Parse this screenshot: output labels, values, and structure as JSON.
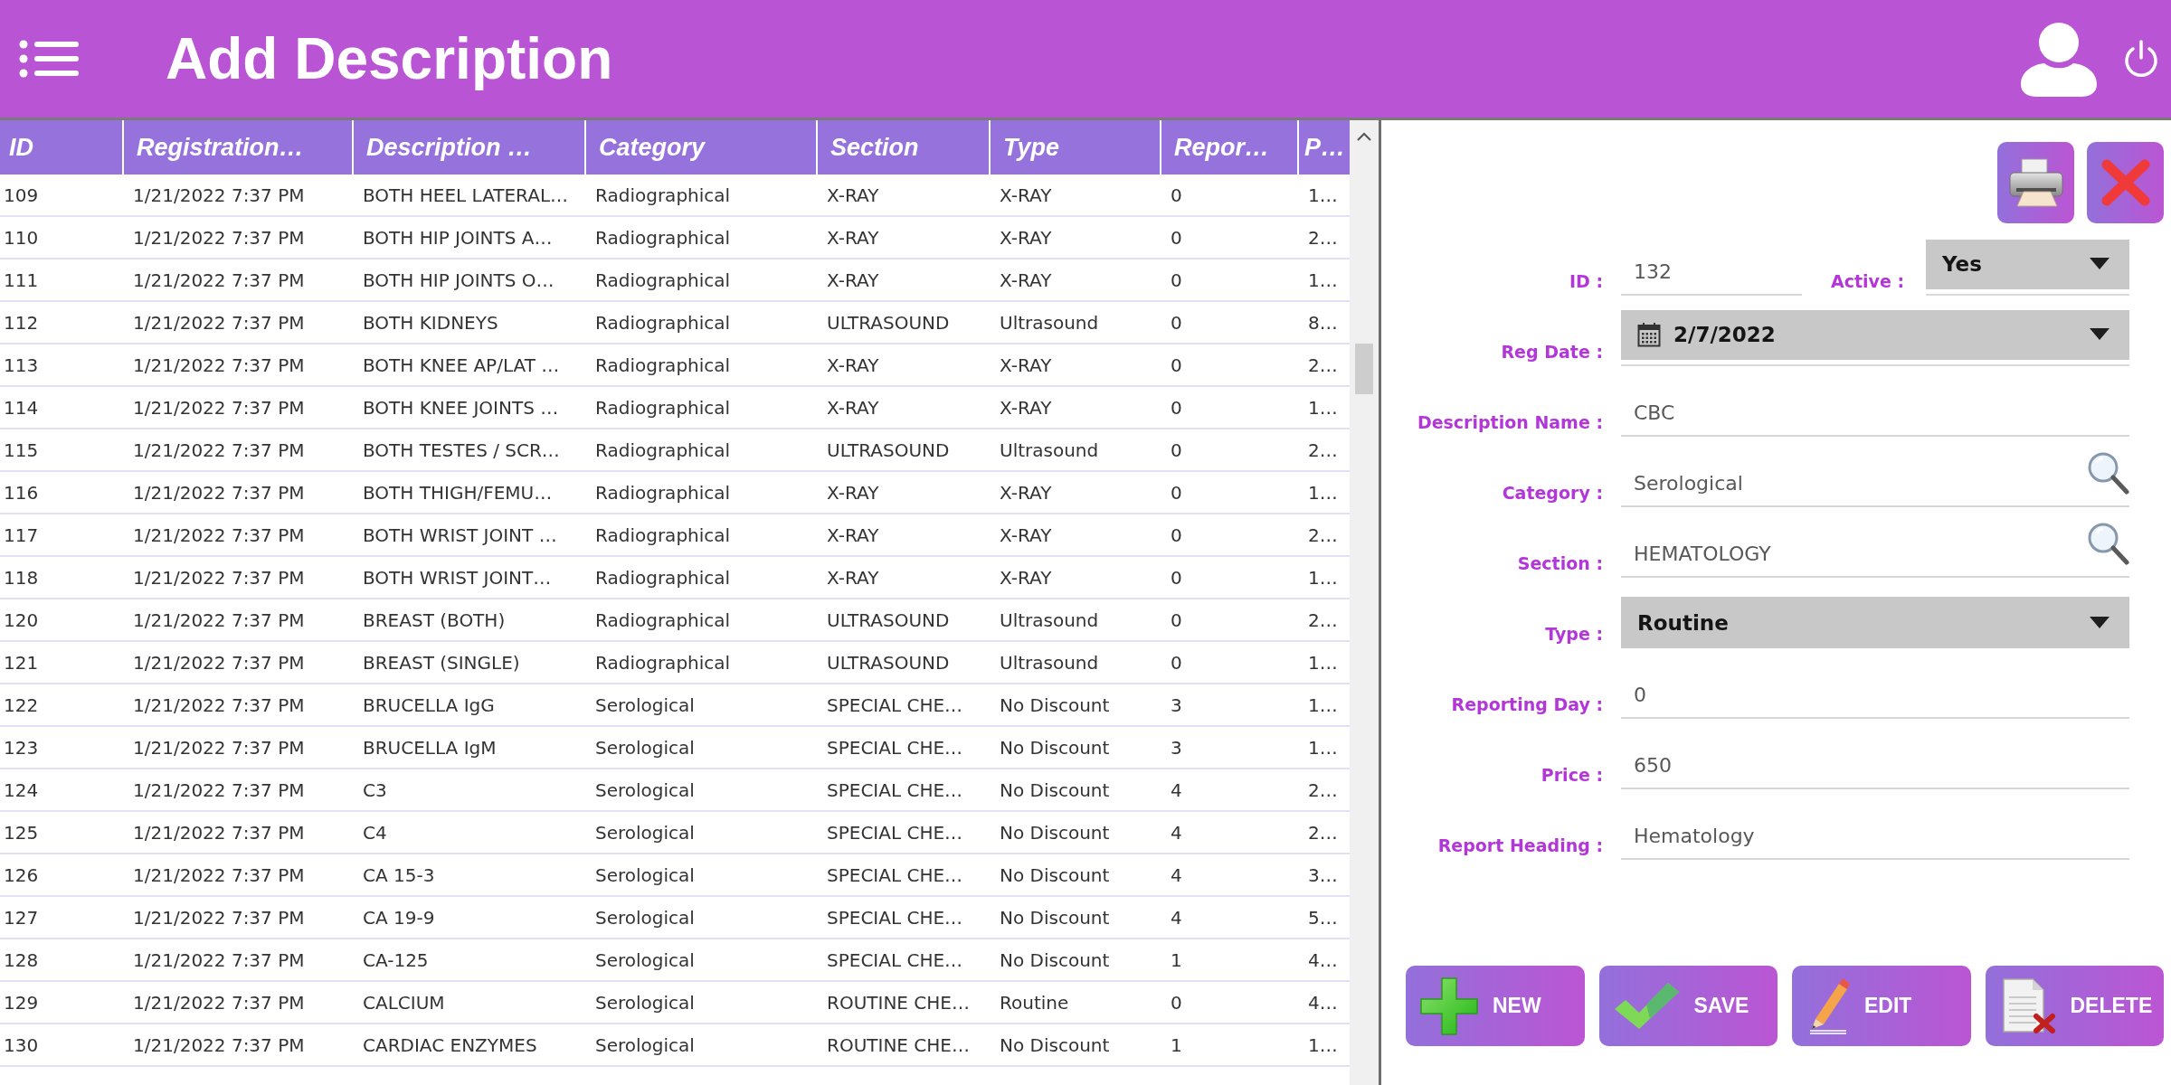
{
  "header": {
    "title": "Add Description"
  },
  "table": {
    "columns": [
      "ID",
      "Registration…",
      "Description …",
      "Category",
      "Section",
      "Type",
      "Repor…",
      "P…"
    ],
    "rows": [
      {
        "cells": [
          "109",
          "1/21/2022 7:37 PM",
          "BOTH HEEL LATERAL…",
          "Radiographical",
          "X-RAY",
          "X-RAY",
          "0",
          "1…"
        ]
      },
      {
        "cells": [
          "110",
          "1/21/2022 7:37 PM",
          "BOTH HIP JOINTS A…",
          "Radiographical",
          "X-RAY",
          "X-RAY",
          "0",
          "2…"
        ]
      },
      {
        "cells": [
          "111",
          "1/21/2022 7:37 PM",
          "BOTH HIP JOINTS O…",
          "Radiographical",
          "X-RAY",
          "X-RAY",
          "0",
          "1…"
        ]
      },
      {
        "cells": [
          "112",
          "1/21/2022 7:37 PM",
          "BOTH KIDNEYS",
          "Radiographical",
          "ULTRASOUND",
          "Ultrasound",
          "0",
          "8…"
        ]
      },
      {
        "cells": [
          "113",
          "1/21/2022 7:37 PM",
          "BOTH KNEE AP/LAT …",
          "Radiographical",
          "X-RAY",
          "X-RAY",
          "0",
          "2…"
        ]
      },
      {
        "cells": [
          "114",
          "1/21/2022 7:37 PM",
          "BOTH KNEE JOINTS …",
          "Radiographical",
          "X-RAY",
          "X-RAY",
          "0",
          "1…"
        ]
      },
      {
        "cells": [
          "115",
          "1/21/2022 7:37 PM",
          "BOTH TESTES / SCR…",
          "Radiographical",
          "ULTRASOUND",
          "Ultrasound",
          "0",
          "2…"
        ]
      },
      {
        "cells": [
          "116",
          "1/21/2022 7:37 PM",
          "BOTH THIGH/FEMU…",
          "Radiographical",
          "X-RAY",
          "X-RAY",
          "0",
          "1…"
        ]
      },
      {
        "cells": [
          "117",
          "1/21/2022 7:37 PM",
          "BOTH WRIST JOINT …",
          "Radiographical",
          "X-RAY",
          "X-RAY",
          "0",
          "2…"
        ]
      },
      {
        "cells": [
          "118",
          "1/21/2022 7:37 PM",
          "BOTH WRIST JOINT…",
          "Radiographical",
          "X-RAY",
          "X-RAY",
          "0",
          "1…"
        ]
      },
      {
        "cells": [
          "120",
          "1/21/2022 7:37 PM",
          "BREAST (BOTH)",
          "Radiographical",
          "ULTRASOUND",
          "Ultrasound",
          "0",
          "2…"
        ]
      },
      {
        "cells": [
          "121",
          "1/21/2022 7:37 PM",
          "BREAST (SINGLE)",
          "Radiographical",
          "ULTRASOUND",
          "Ultrasound",
          "0",
          "1…"
        ]
      },
      {
        "cells": [
          "122",
          "1/21/2022 7:37 PM",
          "BRUCELLA IgG",
          "Serological",
          "SPECIAL CHE…",
          "No Discount",
          "3",
          "1…"
        ]
      },
      {
        "cells": [
          "123",
          "1/21/2022 7:37 PM",
          "BRUCELLA IgM",
          "Serological",
          "SPECIAL CHE…",
          "No Discount",
          "3",
          "1…"
        ]
      },
      {
        "cells": [
          "124",
          "1/21/2022 7:37 PM",
          "C3",
          "Serological",
          "SPECIAL CHE…",
          "No Discount",
          "4",
          "2…"
        ]
      },
      {
        "cells": [
          "125",
          "1/21/2022 7:37 PM",
          "C4",
          "Serological",
          "SPECIAL CHE…",
          "No Discount",
          "4",
          "2…"
        ]
      },
      {
        "cells": [
          "126",
          "1/21/2022 7:37 PM",
          "CA 15-3",
          "Serological",
          "SPECIAL CHE…",
          "No Discount",
          "4",
          "3…"
        ]
      },
      {
        "cells": [
          "127",
          "1/21/2022 7:37 PM",
          "CA 19-9",
          "Serological",
          "SPECIAL CHE…",
          "No Discount",
          "4",
          "5…"
        ]
      },
      {
        "cells": [
          "128",
          "1/21/2022 7:37 PM",
          "CA-125",
          "Serological",
          "SPECIAL CHE…",
          "No Discount",
          "1",
          "4…"
        ]
      },
      {
        "cells": [
          "129",
          "1/21/2022 7:37 PM",
          "CALCIUM",
          "Serological",
          "ROUTINE CHE…",
          "Routine",
          "0",
          "4…"
        ]
      },
      {
        "cells": [
          "130",
          "1/21/2022 7:37 PM",
          "CARDIAC ENZYMES",
          "Serological",
          "ROUTINE CHE…",
          "No Discount",
          "1",
          "1…"
        ]
      }
    ]
  },
  "panel_buttons": [
    {
      "kind": "print"
    },
    {
      "kind": "close"
    }
  ],
  "form": {
    "id_field": {
      "label": "ID :",
      "value": "132"
    },
    "active_field": {
      "label": "Active :",
      "value": "Yes"
    },
    "fields": [
      {
        "kind": "date",
        "label": "Reg Date :",
        "value": "2/7/2022"
      },
      {
        "kind": "text",
        "label": "Description Name :",
        "value": "CBC"
      },
      {
        "kind": "lookup",
        "label": "Category :",
        "value": "Serological"
      },
      {
        "kind": "lookup",
        "label": "Section :",
        "value": "HEMATOLOGY"
      },
      {
        "kind": "dropdown",
        "label": "Type :",
        "value": "Routine"
      },
      {
        "kind": "text",
        "label": "Reporting Day :",
        "value": "0"
      },
      {
        "kind": "text",
        "label": "Price :",
        "value": "650"
      },
      {
        "kind": "text",
        "label": "Report Heading :",
        "value": "Hematology"
      }
    ]
  },
  "actions": [
    {
      "kind": "new",
      "label": "NEW"
    },
    {
      "kind": "save",
      "label": "SAVE"
    },
    {
      "kind": "edit",
      "label": "EDIT"
    },
    {
      "kind": "delete",
      "label": "DELETE"
    }
  ]
}
